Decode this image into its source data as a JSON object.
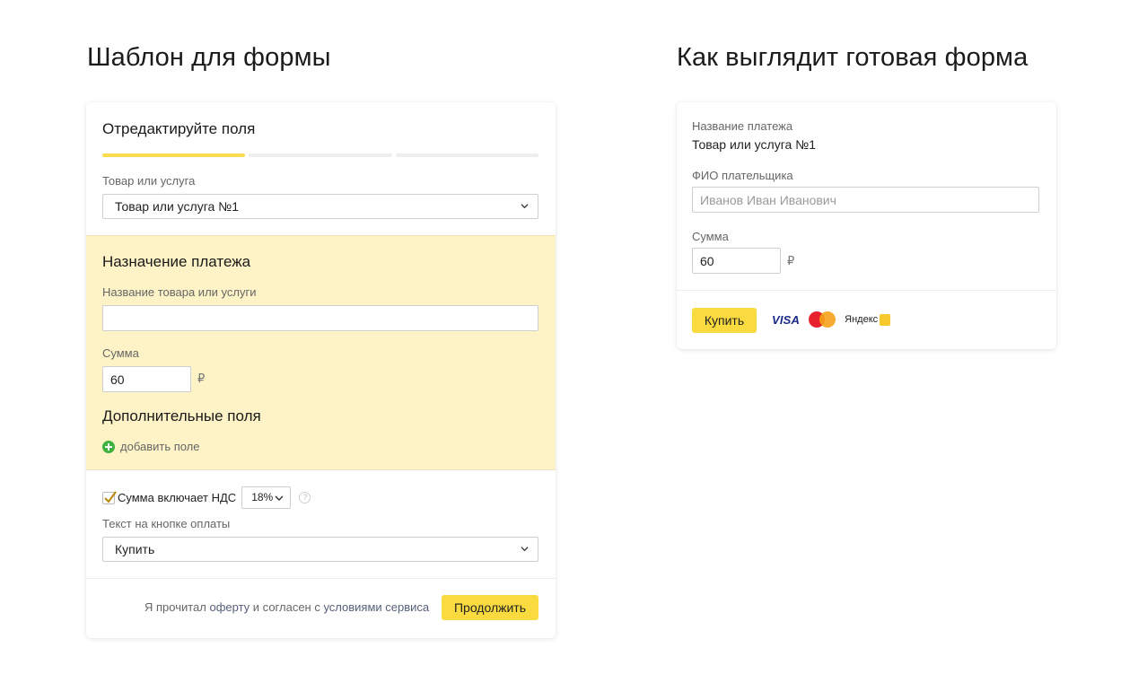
{
  "left_heading": "Шаблон для формы",
  "right_heading": "Как выглядит готовая форма",
  "editor": {
    "step_title": "Отредактируйте поля",
    "progress": {
      "active_step": 1,
      "total_steps": 3
    },
    "product_label": "Товар или услуга",
    "product_value": "Товар или услуга №1",
    "purpose_title": "Назначение платежа",
    "name_label": "Название товара или услуги",
    "name_value": "",
    "amount_label": "Сумма",
    "amount_value": "60",
    "currency": "₽",
    "extra_title": "Дополнительные поля",
    "add_field": "добавить поле",
    "vat_label": "Сумма включает НДС",
    "vat_checked": true,
    "vat_rate": "18%",
    "help_mark": "?",
    "button_text_label": "Текст на кнопке оплаты",
    "button_text_value": "Купить",
    "agree_prefix": "Я прочитал ",
    "agree_link1": "оферту",
    "agree_middle": " и согласен с ",
    "agree_link2": "условиями сервиса",
    "continue_label": "Продолжить"
  },
  "preview": {
    "payment_name_label": "Название платежа",
    "payment_name_value": "Товар или услуга №1",
    "payer_label": "ФИО плательщика",
    "payer_placeholder": "Иванов Иван Иванович",
    "amount_label": "Сумма",
    "amount_value": "60",
    "currency": "₽",
    "buy_label": "Купить",
    "visa_text": "VISA",
    "yandex_text": "Яндекс"
  },
  "colors": {
    "accent_yellow": "#fadb3f",
    "section_bg": "#fdf3c6",
    "add_icon_green": "#3fb23f"
  }
}
